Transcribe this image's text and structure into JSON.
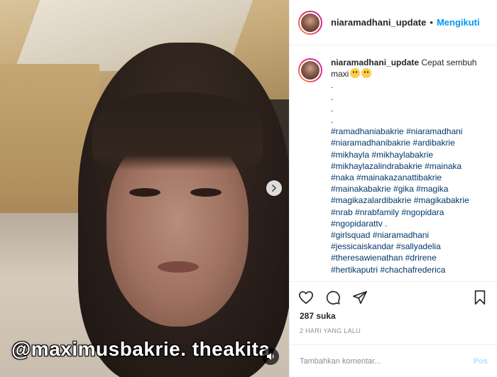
{
  "post": {
    "media_overlay_text": "@maximusbakrie. theakita",
    "media_description": ""
  },
  "header": {
    "username": "niaramadhani_update",
    "separator": "•",
    "follow_label": "Mengikuti"
  },
  "caption": {
    "username": "niaramadhani_update",
    "text_line1": "Cepat sembuh",
    "text_line2": "maxi",
    "dot_lines": [
      ".",
      ".",
      ".",
      "."
    ],
    "hashtag_lines": [
      "#ramadhaniabakrie #niaramadhani",
      "#niaramadhanibakrie #ardibakrie",
      "#mikhayla #mikhaylabakrie",
      "#mikhaylazalindrabakrie #mainaka",
      "#naka #mainakazanattibakrie",
      "#mainakabakrie #gika #magika",
      "#magikazalardibakrie #magikabakrie",
      "#nrab #nrabfamily #ngopidara",
      "#ngopidarattv .",
      "#girlsquad #niaramadhani",
      "#jessicaiskandar #sallyadelia",
      "#theresawienathan #drirene",
      "#hertikaputri #chachafrederica"
    ]
  },
  "actions": {
    "likes": "287 suka",
    "timestamp": "2 HARI YANG LALU"
  },
  "comment": {
    "placeholder": "Tambahkan komentar...",
    "post_label": "Pos"
  },
  "colors": {
    "link_blue": "#0095f6",
    "hashtag": "#00376b",
    "muted": "#8e8e8e",
    "post_disabled": "#b2dffc"
  }
}
